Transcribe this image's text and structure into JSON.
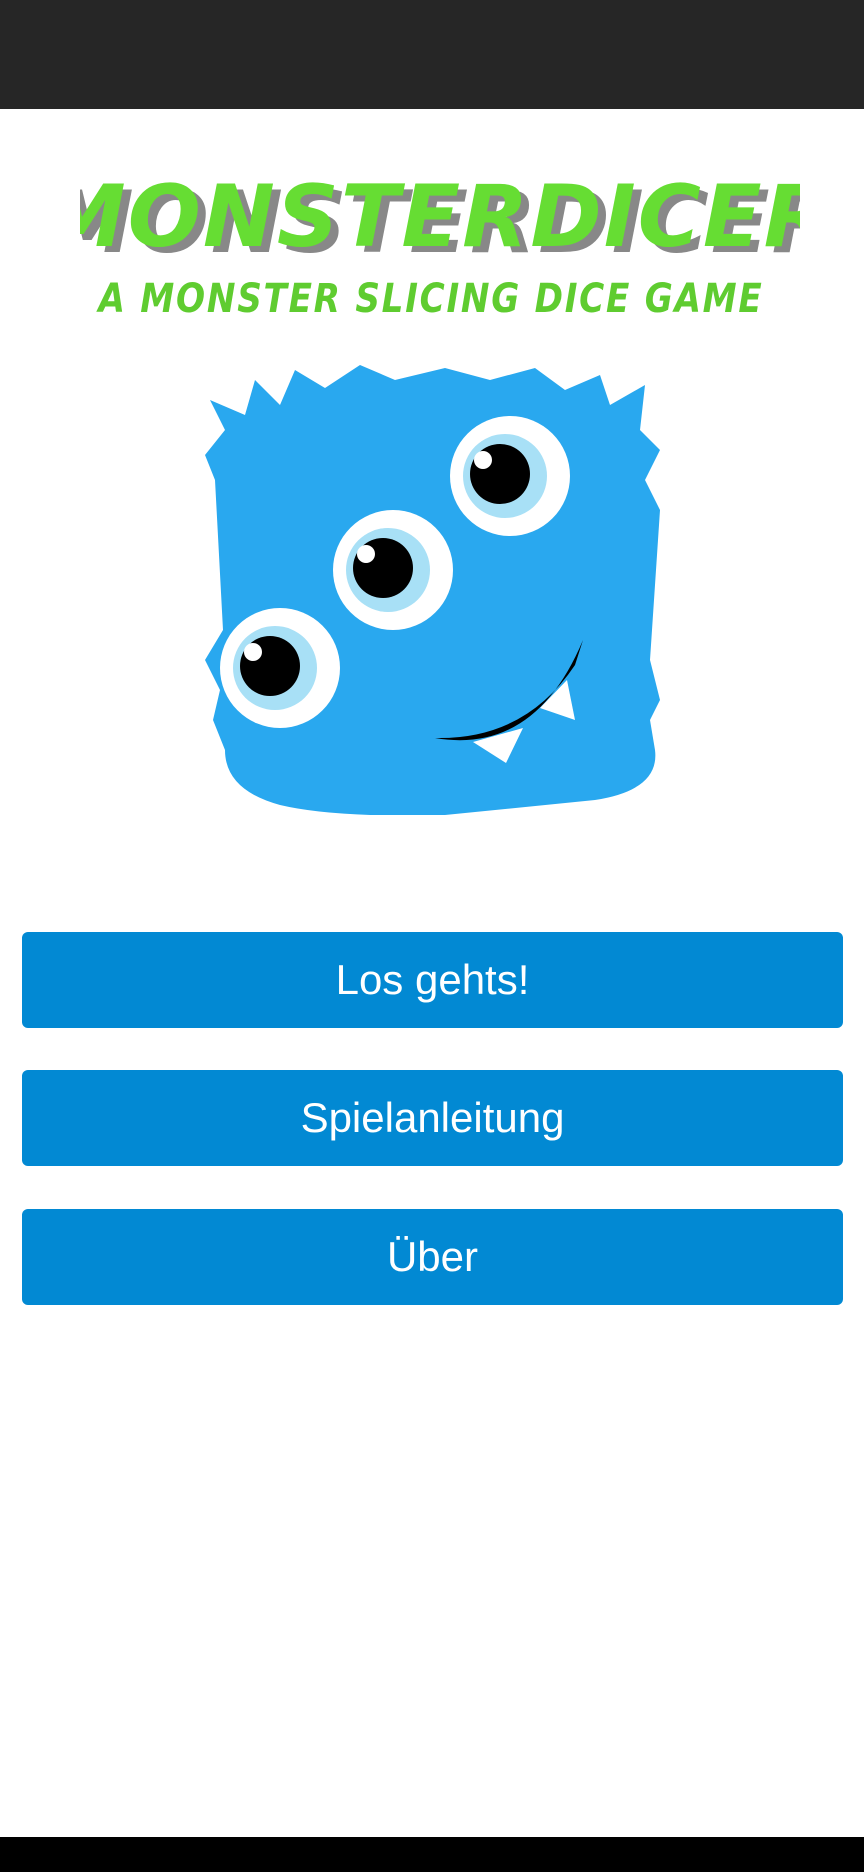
{
  "logo": {
    "title": "MONSTERDICER",
    "subtitle": "A MONSTER SLICING DICE GAME",
    "color": "#66dd33",
    "shadow_color": "#888888"
  },
  "mascot": {
    "icon": "blue-three-eyed-monster-icon",
    "body_color": "#29a8ef"
  },
  "menu": {
    "start_label": "Los gehts!",
    "rules_label": "Spielanleitung",
    "about_label": "Über",
    "button_color": "#0289d3"
  }
}
